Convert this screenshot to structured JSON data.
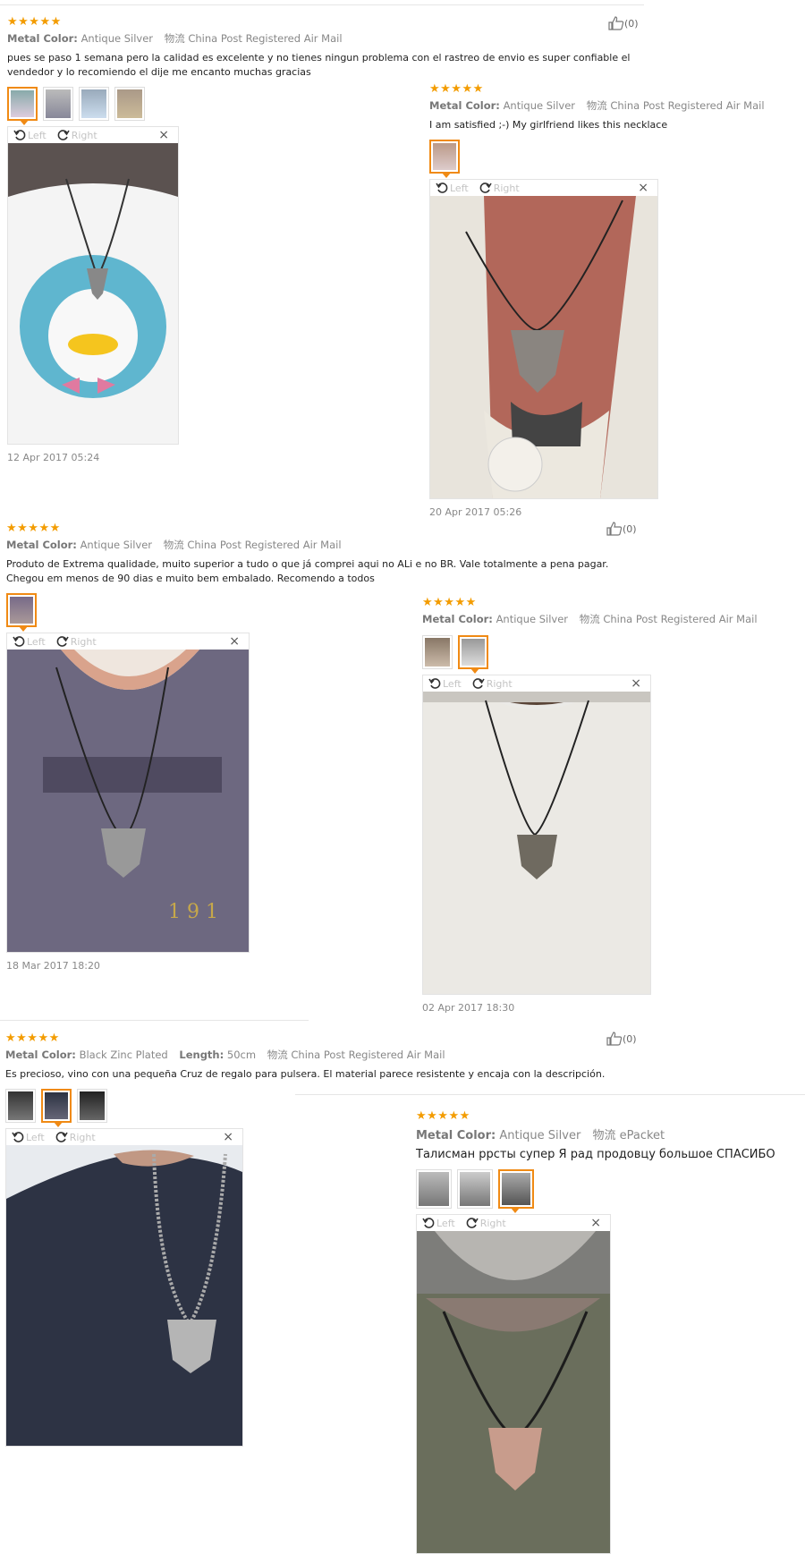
{
  "viewer": {
    "left": "Left",
    "right": "Right",
    "close": "×"
  },
  "reviews": [
    {
      "stars": "★★★★★",
      "meta": [
        {
          "k": "Metal Color:",
          "v": "Antique Silver"
        },
        {
          "k": "",
          "v": "物流 China Post Registered Air Mail"
        }
      ],
      "text": "pues se paso 1 semana pero la calidad es excelente y no tienes ningun problema con el rastreo de envio es super confiable el vendedor y lo recomiendo el dije me encanto muchas gracias",
      "date": "12 Apr 2017 05:24",
      "helpful": "(0)"
    },
    {
      "stars": "★★★★★",
      "meta": [
        {
          "k": "Metal Color:",
          "v": "Antique Silver"
        },
        {
          "k": "",
          "v": "物流 China Post Registered Air Mail"
        }
      ],
      "text": "I am satisfied ;-) My girlfriend likes this necklace",
      "date": "20 Apr 2017 05:26",
      "helpful": "(0)"
    },
    {
      "stars": "★★★★★",
      "meta": [
        {
          "k": "Metal Color:",
          "v": "Antique Silver"
        },
        {
          "k": "",
          "v": "物流 China Post Registered Air Mail"
        }
      ],
      "text": "Produto de Extrema qualidade, muito superior a tudo o que já comprei aqui no ALi e no BR. Vale totalmente a pena pagar. Chegou em menos de 90 dias e muito bem embalado. Recomendo a todos",
      "date": "18 Mar 2017 18:20",
      "helpful": ""
    },
    {
      "stars": "★★★★★",
      "meta": [
        {
          "k": "Metal Color:",
          "v": "Antique Silver"
        },
        {
          "k": "",
          "v": "物流 China Post Registered Air Mail"
        }
      ],
      "text": "",
      "date": "02 Apr 2017 18:30",
      "helpful": "(0)"
    },
    {
      "stars": "★★★★★",
      "meta": [
        {
          "k": "Metal Color:",
          "v": "Black Zinc Plated"
        },
        {
          "k": "Length:",
          "v": "50cm"
        },
        {
          "k": "",
          "v": "物流 China Post Registered Air Mail"
        }
      ],
      "text": "Es precioso, vino con una pequeña Cruz de regalo para pulsera. El material parece resistente y encaja con la descripción.",
      "date": "",
      "helpful": ""
    },
    {
      "stars": "★★★★★",
      "meta": [
        {
          "k": "Metal Color:",
          "v": "Antique Silver"
        },
        {
          "k": "",
          "v": "物流 ePacket"
        }
      ],
      "text": "Талисман ррсты супер Я рад продовцу большое СПАСИБО",
      "date": "",
      "helpful": ""
    }
  ]
}
